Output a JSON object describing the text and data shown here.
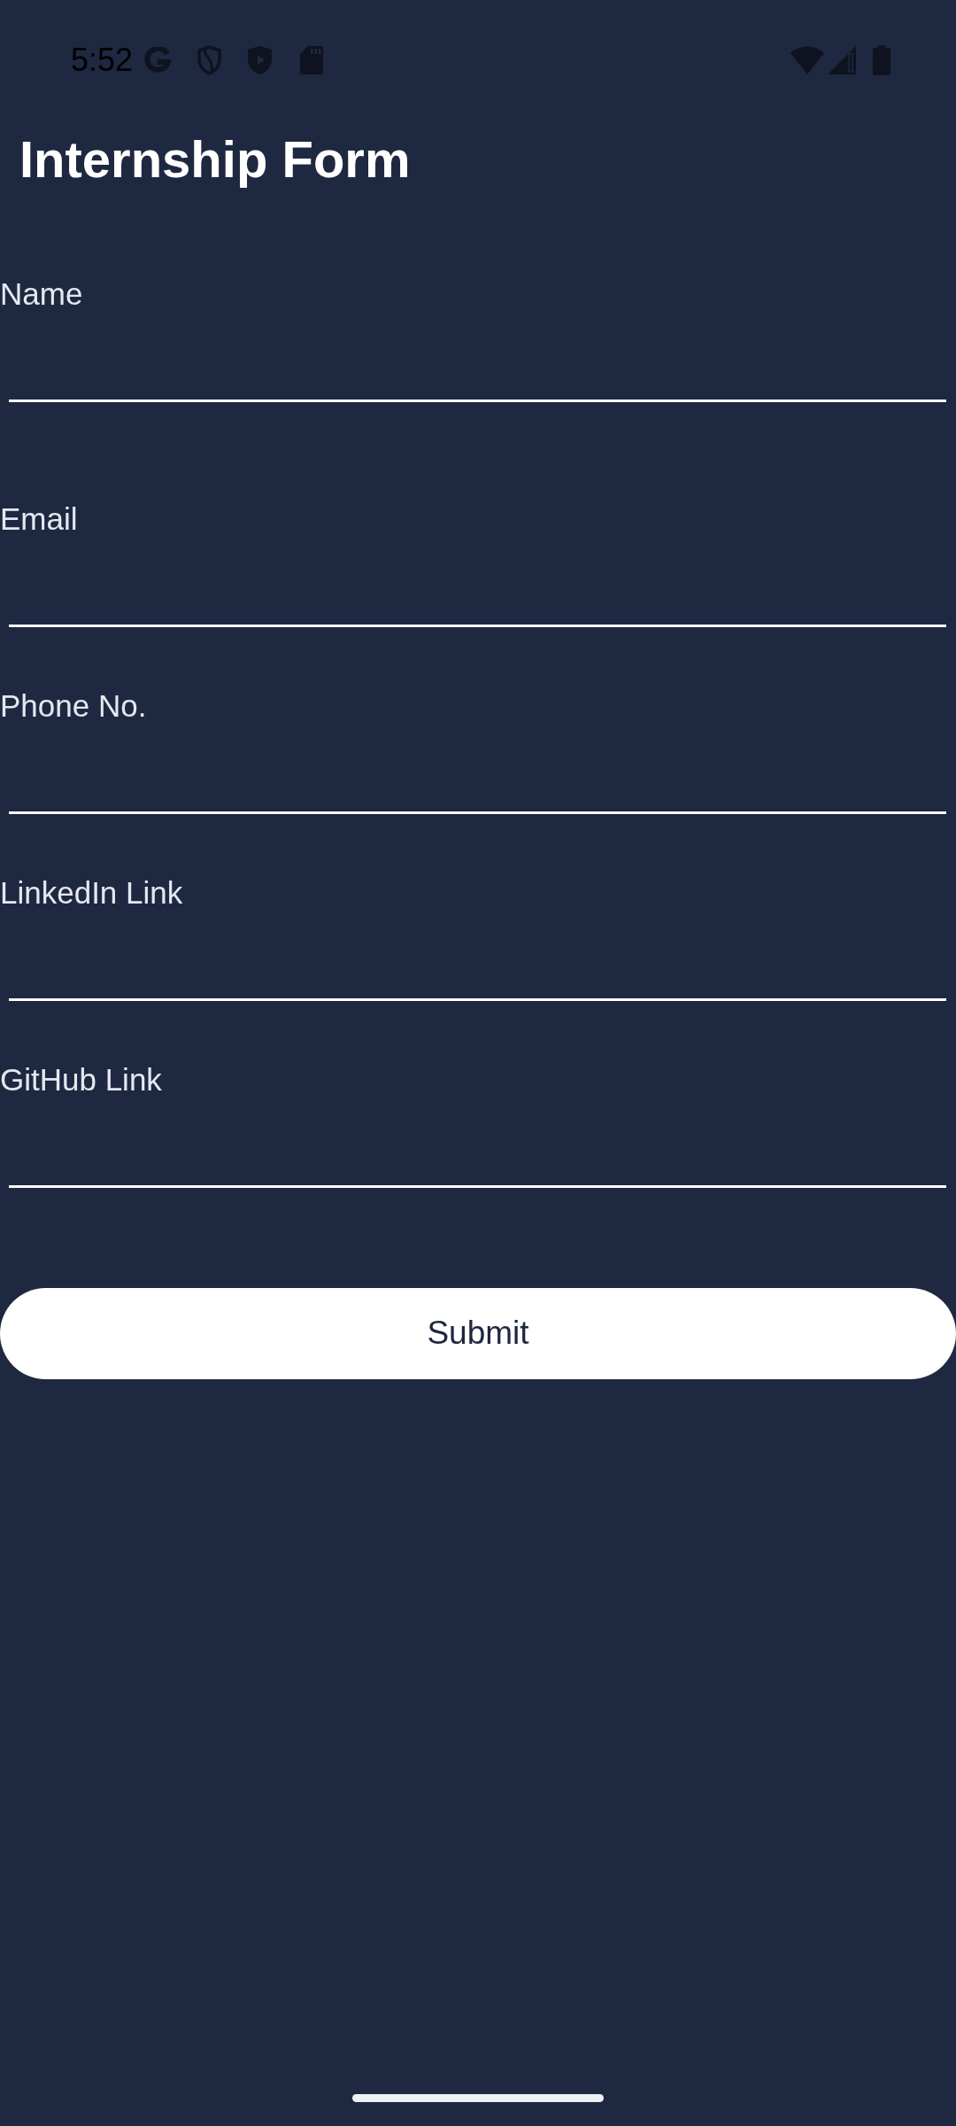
{
  "status_bar": {
    "time": "5:52"
  },
  "title": "Internship Form",
  "fields": [
    {
      "label": "Name"
    },
    {
      "label": "Email"
    },
    {
      "label": "Phone No."
    },
    {
      "label": "LinkedIn Link"
    },
    {
      "label": "GitHub Link"
    }
  ],
  "submit_button": {
    "label": "Submit"
  }
}
